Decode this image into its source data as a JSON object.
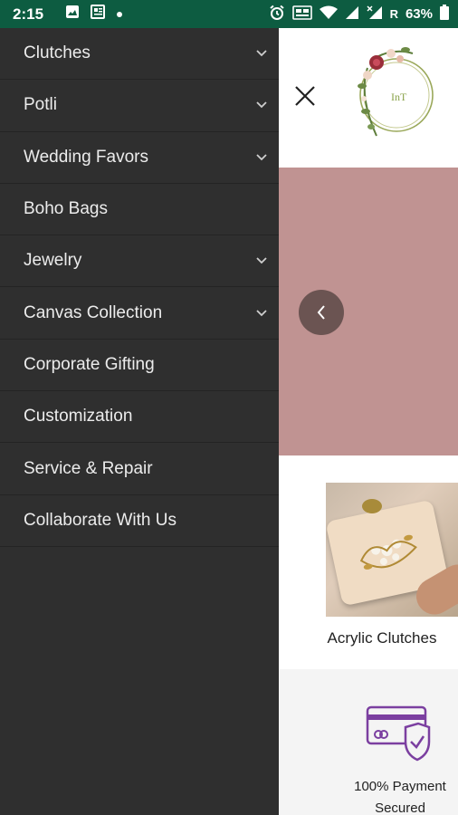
{
  "status_bar": {
    "time": "2:15",
    "network_label": "R",
    "battery": "63%"
  },
  "drawer": {
    "items": [
      {
        "label": "Clutches",
        "has_submenu": true
      },
      {
        "label": "Potli",
        "has_submenu": true
      },
      {
        "label": "Wedding Favors",
        "has_submenu": true
      },
      {
        "label": "Boho Bags",
        "has_submenu": false
      },
      {
        "label": "Jewelry",
        "has_submenu": true
      },
      {
        "label": "Canvas Collection",
        "has_submenu": true
      },
      {
        "label": "Corporate Gifting",
        "has_submenu": false
      },
      {
        "label": "Customization",
        "has_submenu": false
      },
      {
        "label": "Service & Repair",
        "has_submenu": false
      },
      {
        "label": "Collaborate With Us",
        "has_submenu": false
      }
    ]
  },
  "header": {
    "logo_text": "InT"
  },
  "product": {
    "name": "Acrylic Clutches"
  },
  "feature": {
    "line1": "100% Payment",
    "line2": "Secured"
  },
  "colors": {
    "status_bar": "#0d5c41",
    "drawer_bg": "#2f2f2f",
    "hero_bg": "#c09392",
    "accent_purple": "#7b3fa0"
  }
}
